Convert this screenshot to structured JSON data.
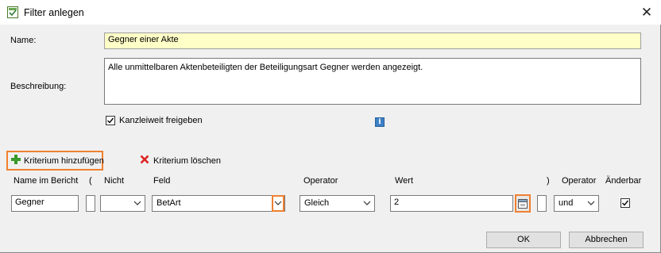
{
  "window": {
    "title": "Filter anlegen",
    "close_icon": "close-icon"
  },
  "form": {
    "name_label": "Name:",
    "name_value": "Gegner einer Akte",
    "description_label": "Beschreibung:",
    "description_value": "Alle unmittelbaren Aktenbeteiligten der Beteiligungsart Gegner werden angezeigt.",
    "share_label": "Kanzleiweit freigeben",
    "share_checked": true,
    "info_icon": "info-icon"
  },
  "toolbar": {
    "add_label": "Kriterium hinzufügen",
    "delete_label": "Kriterium löschen"
  },
  "criteria": {
    "headers": {
      "name": "Name im Bericht",
      "open_paren": "(",
      "not": "Nicht",
      "field": "Feld",
      "operator": "Operator",
      "value": "Wert",
      "close_paren": ")",
      "operator2": "Operator",
      "editable": "Änderbar"
    },
    "rows": [
      {
        "name": "Gegner",
        "open_paren": "",
        "not": "",
        "field": "BetArt",
        "operator": "Gleich",
        "value": "2",
        "close_paren": "",
        "operator2": "und",
        "editable": true
      }
    ]
  },
  "buttons": {
    "ok": "OK",
    "cancel": "Abbrechen"
  }
}
